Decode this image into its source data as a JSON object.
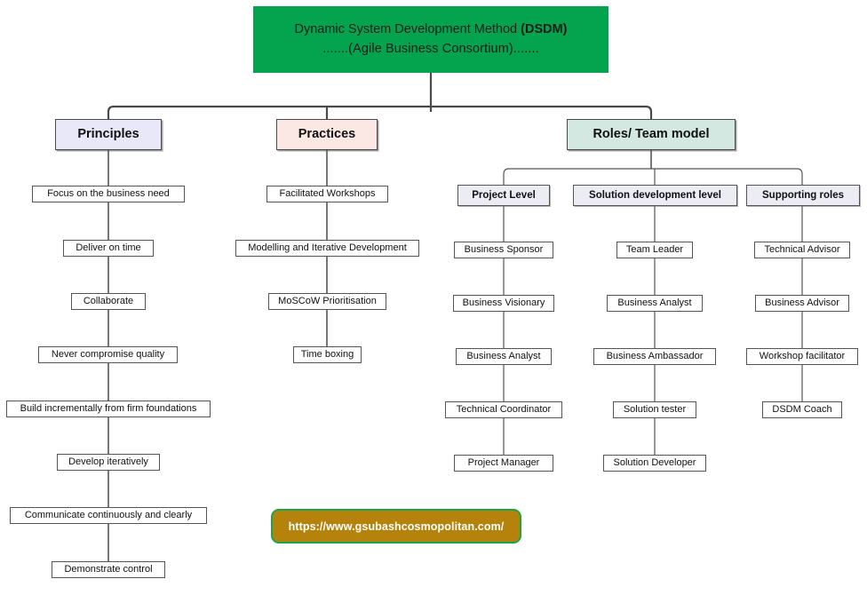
{
  "diagram": {
    "type": "org-tree",
    "root": {
      "line1_plain": "Dynamic System Development Method ",
      "line1_bold": "(DSDM)",
      "line2": ".......(Agile Business Consortium).......",
      "color": "#04a44e"
    },
    "branches": [
      {
        "id": "principles",
        "label": "Principles",
        "color": "#e8e8f8",
        "items": [
          "Focus on the business need",
          "Deliver on time",
          "Collaborate",
          "Never compromise quality",
          "Build incrementally from firm foundations",
          "Develop iteratively",
          "Communicate continuously and clearly",
          "Demonstrate control"
        ]
      },
      {
        "id": "practices",
        "label": "Practices",
        "color": "#fbe8e4",
        "items": [
          "Facilitated Workshops",
          "Modelling and Iterative Development",
          "MoSCoW Prioritisation",
          "Time boxing"
        ]
      },
      {
        "id": "roles",
        "label": "Roles/ Team model",
        "color": "#d4e8e2",
        "subgroups": [
          {
            "id": "project-level",
            "label": "Project Level",
            "items": [
              "Business Sponsor",
              "Business Visionary",
              "Business Analyst",
              "Technical Coordinator",
              "Project Manager"
            ]
          },
          {
            "id": "solution-development-level",
            "label": "Solution development level",
            "items": [
              "Team Leader",
              "Business Analyst",
              "Business Ambassador",
              "Solution tester",
              "Solution Developer"
            ]
          },
          {
            "id": "supporting-roles",
            "label": "Supporting roles",
            "items": [
              "Technical Advisor",
              "Business Advisor",
              "Workshop facilitator",
              "DSDM  Coach"
            ]
          }
        ]
      }
    ],
    "watermark": {
      "url_text": "https://www.gsubashcosmopolitan.com/",
      "fill": "#b5820c",
      "border": "#17a74a"
    }
  }
}
